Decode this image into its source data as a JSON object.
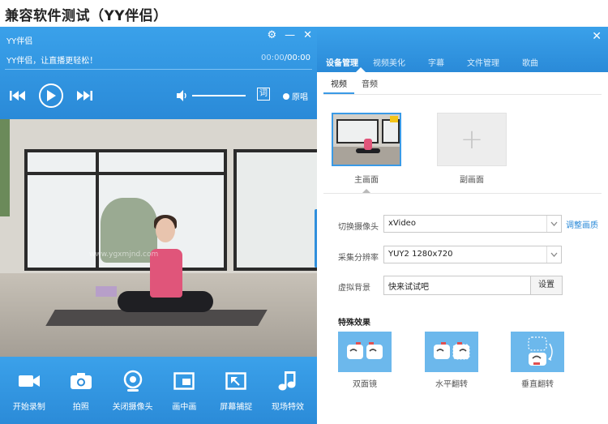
{
  "page_title": "兼容软件测试（YY伴侣）",
  "player": {
    "app_name": "YY伴侣",
    "slogan": "YY伴侣，让直播更轻松！",
    "time_current": "00:00",
    "time_sep": "/",
    "time_total": "00:00",
    "lyric_label": "词",
    "original_label": "原唱",
    "watermark": "www.ygxmjnd.com",
    "toolbar": [
      {
        "label": "开始录制",
        "icon": "video-camera-icon"
      },
      {
        "label": "拍照",
        "icon": "camera-icon"
      },
      {
        "label": "关闭摄像头",
        "icon": "webcam-icon"
      },
      {
        "label": "画中画",
        "icon": "picture-in-picture-icon"
      },
      {
        "label": "屏幕捕捉",
        "icon": "screen-capture-icon"
      },
      {
        "label": "现场特效",
        "icon": "music-note-icon"
      }
    ]
  },
  "panel": {
    "tabs": [
      "设备管理",
      "视频美化",
      "字幕",
      "文件管理",
      "歌曲"
    ],
    "sub_tabs": [
      "视频",
      "音频"
    ],
    "thumb_main_label": "主画面",
    "thumb_sub_label": "副画面",
    "camera_label": "切换摄像头",
    "camera_value": "xVideo",
    "adjust_link": "调整画质",
    "resolution_label": "采集分辨率",
    "resolution_value": "YUY2 1280x720",
    "bg_label": "虚拟背景",
    "bg_value": "快来试试吧",
    "bg_button": "设置",
    "fx_title": "特殊效果",
    "fx": [
      "双面镜",
      "水平翻转",
      "垂直翻转"
    ]
  },
  "colors": {
    "accent": "#2f8fdc",
    "fx_tile": "#6cb8ec"
  }
}
